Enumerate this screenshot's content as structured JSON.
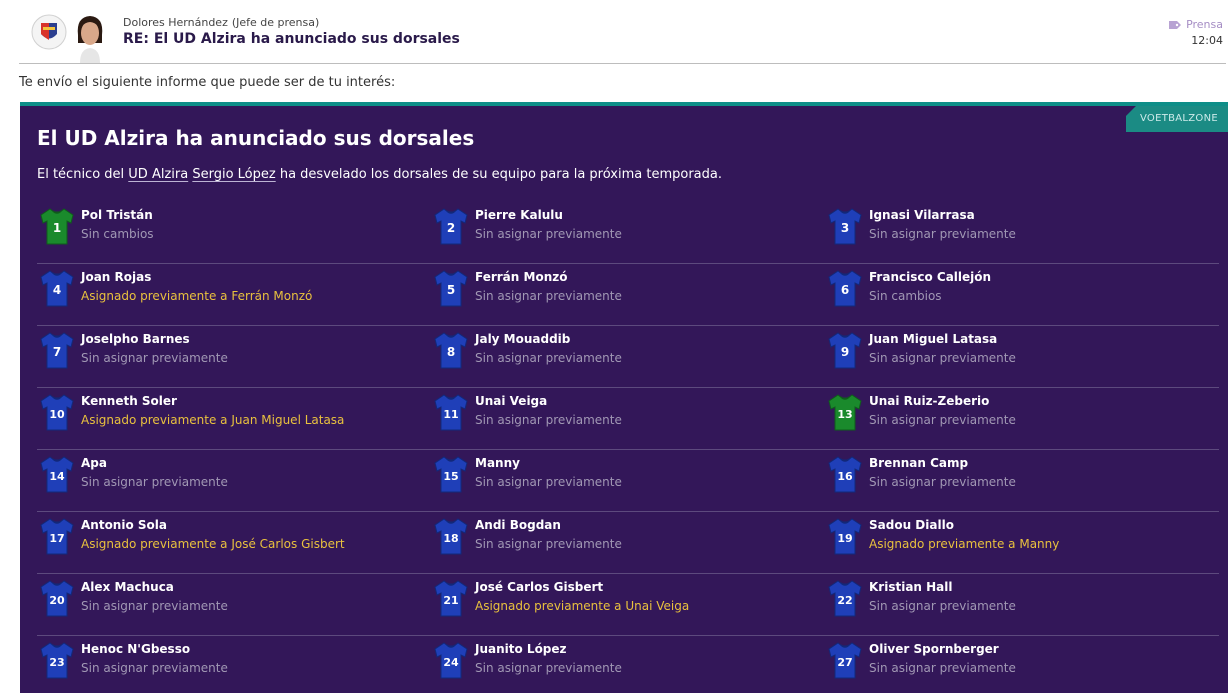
{
  "message": {
    "sender_name": "Dolores Hernández",
    "sender_role": "(Jefe de prensa)",
    "subject": "RE: El UD Alzira ha anunciado sus dorsales",
    "category": "Prensa",
    "time": "12:04",
    "intro": "Te envío el siguiente informe que puede ser de tu interés:"
  },
  "article": {
    "source": "VOETBALZONE",
    "title": "El UD Alzira ha anunciado sus dorsales",
    "body_prefix": "El técnico del ",
    "club_link": "UD Alzira",
    "coach_link": "Sergio López",
    "body_suffix": " ha desvelado los dorsales de su equipo para la próxima temporada."
  },
  "colors": {
    "panel": "#331759",
    "accent": "#0e8e88",
    "outfield_shirt": "#1f3fb8",
    "keeper_shirt": "#1a8a2c",
    "highlight": "#e9c13e",
    "muted": "#a198b4"
  },
  "players": [
    {
      "number": "1",
      "name": "Pol Tristán",
      "status": "Sin cambios",
      "changed": false,
      "keeper": true
    },
    {
      "number": "2",
      "name": "Pierre Kalulu",
      "status": "Sin asignar previamente",
      "changed": false,
      "keeper": false
    },
    {
      "number": "3",
      "name": "Ignasi Vilarrasa",
      "status": "Sin asignar previamente",
      "changed": false,
      "keeper": false
    },
    {
      "number": "4",
      "name": "Joan Rojas",
      "status": "Asignado previamente a Ferrán Monzó",
      "changed": true,
      "keeper": false
    },
    {
      "number": "5",
      "name": "Ferrán Monzó",
      "status": "Sin asignar previamente",
      "changed": false,
      "keeper": false
    },
    {
      "number": "6",
      "name": "Francisco Callejón",
      "status": "Sin cambios",
      "changed": false,
      "keeper": false
    },
    {
      "number": "7",
      "name": "Joselpho Barnes",
      "status": "Sin asignar previamente",
      "changed": false,
      "keeper": false
    },
    {
      "number": "8",
      "name": "Jaly Mouaddib",
      "status": "Sin asignar previamente",
      "changed": false,
      "keeper": false
    },
    {
      "number": "9",
      "name": "Juan Miguel Latasa",
      "status": "Sin asignar previamente",
      "changed": false,
      "keeper": false
    },
    {
      "number": "10",
      "name": "Kenneth Soler",
      "status": "Asignado previamente a Juan Miguel Latasa",
      "changed": true,
      "keeper": false
    },
    {
      "number": "11",
      "name": "Unai Veiga",
      "status": "Sin asignar previamente",
      "changed": false,
      "keeper": false
    },
    {
      "number": "13",
      "name": "Unai Ruiz-Zeberio",
      "status": "Sin asignar previamente",
      "changed": false,
      "keeper": true
    },
    {
      "number": "14",
      "name": "Apa",
      "status": "Sin asignar previamente",
      "changed": false,
      "keeper": false
    },
    {
      "number": "15",
      "name": "Manny",
      "status": "Sin asignar previamente",
      "changed": false,
      "keeper": false
    },
    {
      "number": "16",
      "name": "Brennan Camp",
      "status": "Sin asignar previamente",
      "changed": false,
      "keeper": false
    },
    {
      "number": "17",
      "name": "Antonio Sola",
      "status": "Asignado previamente a José Carlos Gisbert",
      "changed": true,
      "keeper": false
    },
    {
      "number": "18",
      "name": "Andi Bogdan",
      "status": "Sin asignar previamente",
      "changed": false,
      "keeper": false
    },
    {
      "number": "19",
      "name": "Sadou Diallo",
      "status": "Asignado previamente a Manny",
      "changed": true,
      "keeper": false
    },
    {
      "number": "20",
      "name": "Alex Machuca",
      "status": "Sin asignar previamente",
      "changed": false,
      "keeper": false
    },
    {
      "number": "21",
      "name": "José Carlos Gisbert",
      "status": "Asignado previamente a Unai Veiga",
      "changed": true,
      "keeper": false
    },
    {
      "number": "22",
      "name": "Kristian Hall",
      "status": "Sin asignar previamente",
      "changed": false,
      "keeper": false
    },
    {
      "number": "23",
      "name": "Henoc N'Gbesso",
      "status": "Sin asignar previamente",
      "changed": false,
      "keeper": false
    },
    {
      "number": "24",
      "name": "Juanito López",
      "status": "Sin asignar previamente",
      "changed": false,
      "keeper": false
    },
    {
      "number": "27",
      "name": "Oliver Spornberger",
      "status": "Sin asignar previamente",
      "changed": false,
      "keeper": false
    }
  ]
}
